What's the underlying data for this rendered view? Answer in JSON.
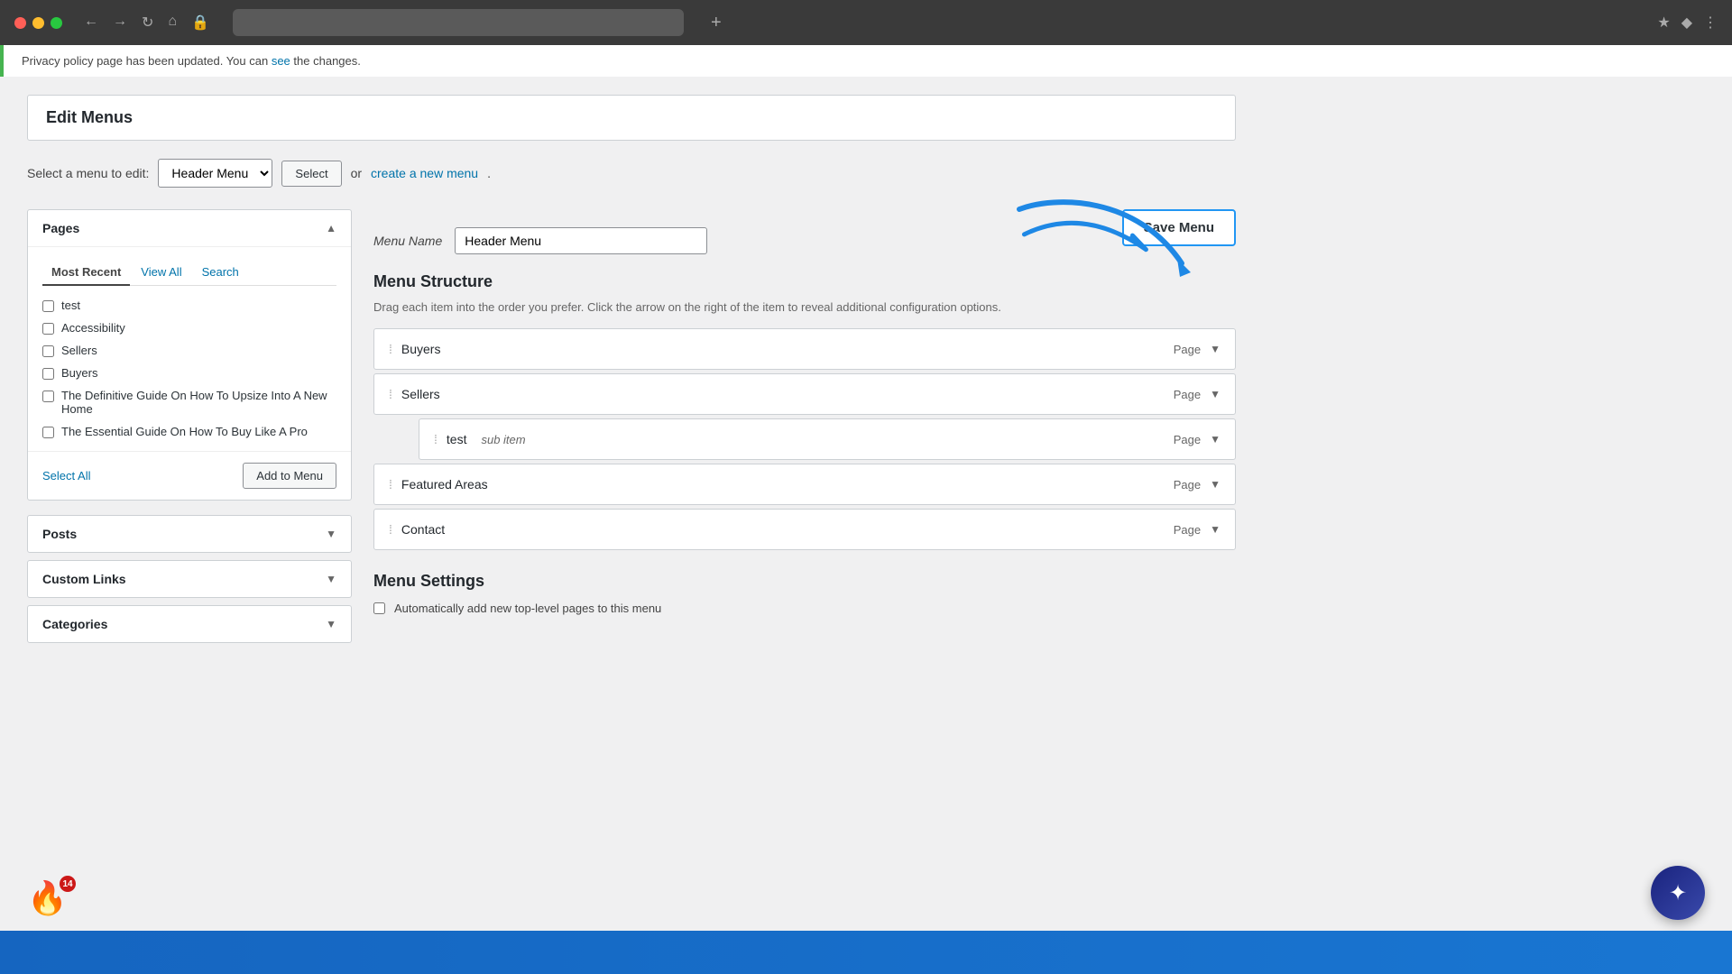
{
  "browser": {
    "dots": [
      "red",
      "yellow",
      "green"
    ],
    "loading_text": "",
    "new_tab_label": "+",
    "nav": [
      "←",
      "→",
      "↻",
      "⌂",
      "🔒"
    ]
  },
  "notification": {
    "text": "Privacy policy page has been updated. You can ",
    "link_text": "see",
    "text_after": " the changes."
  },
  "page": {
    "title": "Edit Menus"
  },
  "menu_select": {
    "label": "Select a menu to edit:",
    "current": "Header Menu",
    "select_btn": "Select",
    "or_text": "or",
    "create_link": "create a new menu",
    "create_suffix": "."
  },
  "left_panel": {
    "pages": {
      "title": "Pages",
      "tabs": [
        "Most Recent",
        "View All",
        "Search"
      ],
      "active_tab": "Most Recent",
      "items": [
        {
          "label": "test",
          "checked": false
        },
        {
          "label": "Accessibility",
          "checked": false
        },
        {
          "label": "Sellers",
          "checked": false
        },
        {
          "label": "Buyers",
          "checked": false
        },
        {
          "label": "The Definitive Guide On How To Upsize Into A New Home",
          "checked": false
        },
        {
          "label": "The Essential Guide On How To Buy Like A Pro",
          "checked": false
        }
      ],
      "select_all": "Select All",
      "add_btn": "Add to Menu"
    },
    "posts": {
      "title": "Posts",
      "collapsed": true
    },
    "custom_links": {
      "title": "Custom Links",
      "collapsed": true
    },
    "categories": {
      "title": "Categories",
      "collapsed": true
    }
  },
  "right_panel": {
    "menu_name_label": "Menu Name",
    "menu_name_value": "Header Menu",
    "structure_title": "Menu Structure",
    "structure_hint": "Drag each item into the order you prefer. Click the arrow on the right of the item to reveal additional configuration options.",
    "menu_items": [
      {
        "name": "Buyers",
        "sub_item": false,
        "type": "Page"
      },
      {
        "name": "Sellers",
        "sub_item": false,
        "type": "Page"
      },
      {
        "name": "test",
        "sub_label": "sub item",
        "sub_item": true,
        "type": "Page"
      },
      {
        "name": "Featured Areas",
        "sub_item": false,
        "type": "Page"
      },
      {
        "name": "Contact",
        "sub_item": false,
        "type": "Page"
      }
    ],
    "settings_title": "Menu Settings",
    "auto_add_label": "Automatically add new top-level pages to this menu",
    "save_btn": "Save Menu"
  },
  "annotation": {
    "arrow_color": "#1e88e5"
  },
  "notifications_count": "14"
}
